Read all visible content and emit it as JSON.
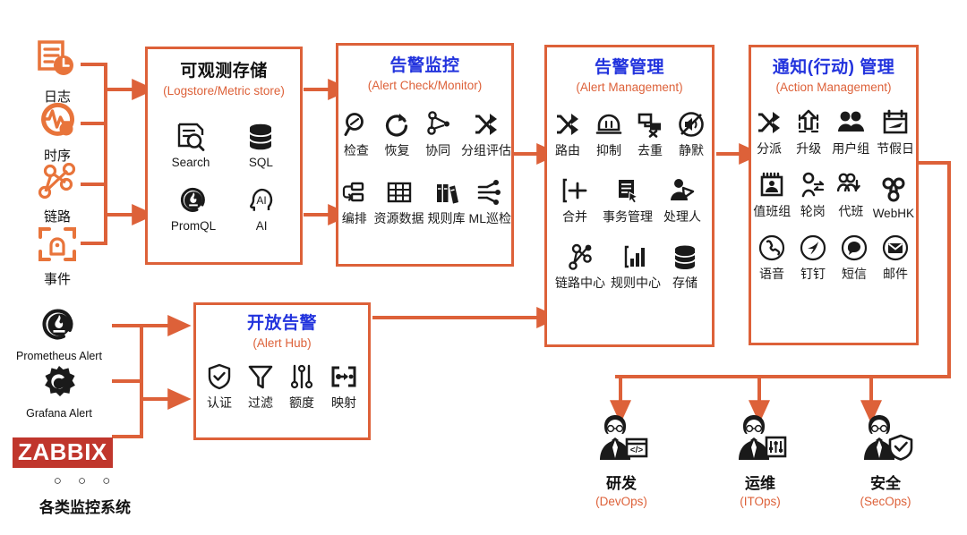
{
  "accent": "#DD6139",
  "title_blue": "#2233DD",
  "zabbix_red": "#C0362C",
  "sources": {
    "items": [
      {
        "name": "日志",
        "icon": "log-document-clock-icon"
      },
      {
        "name": "时序",
        "icon": "metric-pulse-icon"
      },
      {
        "name": "链路",
        "icon": "trace-topology-icon"
      },
      {
        "name": "事件",
        "icon": "event-bracket-icon"
      }
    ]
  },
  "monitor_sources": {
    "items": [
      {
        "name": "Prometheus Alert",
        "icon": "prometheus-icon"
      },
      {
        "name": "Grafana Alert",
        "icon": "grafana-icon"
      },
      {
        "name": "ZABBIX",
        "icon": "zabbix-logo"
      }
    ],
    "dots": "○ ○ ○",
    "caption": "各类监控系统"
  },
  "panels": {
    "storage": {
      "title": "可观测存储",
      "subtitle": "(Logstore/Metric store)",
      "title_color": "#111111",
      "rows": [
        [
          {
            "label": "Search",
            "icon": "search-document-icon"
          },
          {
            "label": "SQL",
            "icon": "database-icon"
          }
        ],
        [
          {
            "label": "PromQL",
            "icon": "prometheus-icon"
          },
          {
            "label": "AI",
            "icon": "ai-head-icon"
          }
        ]
      ]
    },
    "monitor": {
      "title": "告警监控",
      "subtitle": "(Alert Check/Monitor)",
      "title_color": "#2233DD",
      "rows": [
        [
          {
            "label": "检查",
            "icon": "magnifier-icon"
          },
          {
            "label": "恢复",
            "icon": "refresh-icon"
          },
          {
            "label": "协同",
            "icon": "collaborate-node-icon"
          },
          {
            "label": "分组评估",
            "icon": "shuffle-icon"
          }
        ],
        [
          {
            "label": "编排",
            "icon": "orchestrate-icon"
          },
          {
            "label": "资源数据",
            "icon": "table-grid-icon"
          },
          {
            "label": "规则库",
            "icon": "books-icon"
          },
          {
            "label": "ML巡检",
            "icon": "ml-flow-icon"
          }
        ]
      ]
    },
    "management": {
      "title": "告警管理",
      "subtitle": "(Alert Management)",
      "title_color": "#2233DD",
      "rows": [
        [
          {
            "label": "路由",
            "icon": "shuffle-icon"
          },
          {
            "label": "抑制",
            "icon": "suppress-dome-icon"
          },
          {
            "label": "去重",
            "icon": "dedupe-icon"
          },
          {
            "label": "静默",
            "icon": "mute-icon"
          }
        ],
        [
          {
            "label": "合并",
            "icon": "merge-icon"
          },
          {
            "label": "事务管理",
            "icon": "ticket-list-icon"
          },
          {
            "label": "处理人",
            "icon": "handler-person-icon"
          }
        ],
        [
          {
            "label": "链路中心",
            "icon": "trace-center-icon"
          },
          {
            "label": "规则中心",
            "icon": "rule-chart-icon"
          },
          {
            "label": "存储",
            "icon": "database-icon"
          }
        ]
      ]
    },
    "action": {
      "title": "通知(行动) 管理",
      "subtitle": "(Action Management)",
      "title_color": "#2233DD",
      "rows": [
        [
          {
            "label": "分派",
            "icon": "shuffle-icon"
          },
          {
            "label": "升级",
            "icon": "escalate-up-icon"
          },
          {
            "label": "用户组",
            "icon": "users-group-icon"
          },
          {
            "label": "节假日",
            "icon": "holiday-calendar-icon"
          }
        ],
        [
          {
            "label": "值班组",
            "icon": "oncall-calendar-icon"
          },
          {
            "label": "轮岗",
            "icon": "rotation-icon"
          },
          {
            "label": "代班",
            "icon": "substitute-icon"
          },
          {
            "label": "WebHK",
            "icon": "webhook-icon"
          }
        ],
        [
          {
            "label": "语音",
            "icon": "phone-icon"
          },
          {
            "label": "钉钉",
            "icon": "dingtalk-icon"
          },
          {
            "label": "短信",
            "icon": "sms-bubble-icon"
          },
          {
            "label": "邮件",
            "icon": "email-icon"
          }
        ]
      ]
    },
    "hub": {
      "title": "开放告警",
      "subtitle": "(Alert Hub)",
      "title_color": "#2233DD",
      "rows": [
        [
          {
            "label": "认证",
            "icon": "shield-check-icon"
          },
          {
            "label": "过滤",
            "icon": "filter-funnel-icon"
          },
          {
            "label": "额度",
            "icon": "sliders-icon"
          },
          {
            "label": "映射",
            "icon": "mapping-icon"
          }
        ]
      ]
    }
  },
  "personas": [
    {
      "name": "研发",
      "en": "(DevOps)",
      "icon": "developer-person-icon"
    },
    {
      "name": "运维",
      "en": "(ITOps)",
      "icon": "itops-person-icon"
    },
    {
      "name": "安全",
      "en": "(SecOps)",
      "icon": "secops-person-icon"
    }
  ]
}
